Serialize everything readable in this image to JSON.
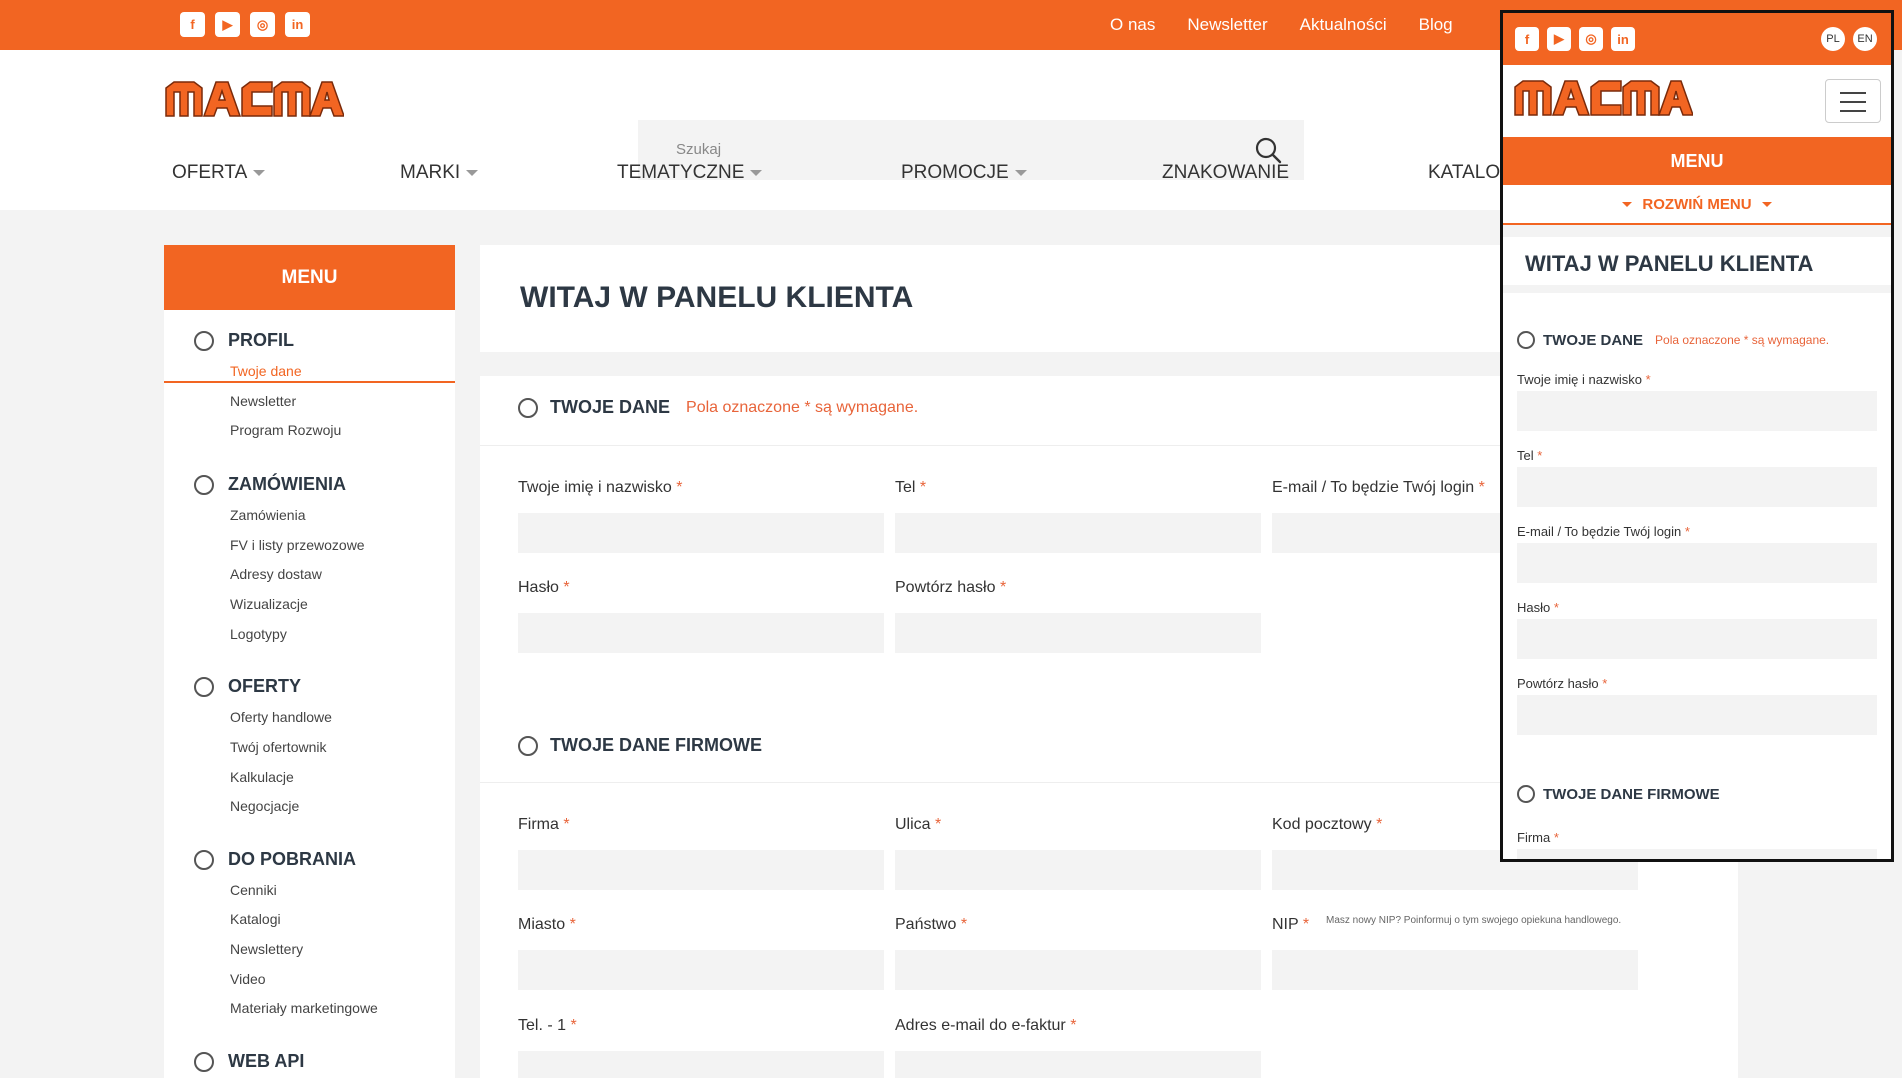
{
  "top_links": [
    "O nas",
    "Newsletter",
    "Aktualności",
    "Blog"
  ],
  "social": [
    {
      "icon": "facebook-icon",
      "glyph": "f"
    },
    {
      "icon": "youtube-icon",
      "glyph": "▶"
    },
    {
      "icon": "instagram-icon",
      "glyph": "◎"
    },
    {
      "icon": "linkedin-icon",
      "glyph": "in"
    }
  ],
  "logo_text": "MACMA",
  "search": {
    "placeholder": "Szukaj"
  },
  "main_nav": [
    "OFERTA",
    "MARKI",
    "TEMATYCZNE",
    "PROMOCJE",
    "ZNAKOWANIE",
    "KATALO"
  ],
  "sidebar": {
    "menu_title": "MENU",
    "sections": [
      {
        "title": "PROFIL",
        "items": [
          "Twoje dane",
          "Newsletter",
          "Program Rozwoju"
        ]
      },
      {
        "title": "ZAMÓWIENIA",
        "items": [
          "Zamówienia",
          "FV i listy przewozowe",
          "Adresy dostaw",
          "Wizualizacje",
          "Logotypy"
        ]
      },
      {
        "title": "OFERTY",
        "items": [
          "Oferty handlowe",
          "Twój ofertownik",
          "Kalkulacje",
          "Negocjacje"
        ]
      },
      {
        "title": "DO POBRANIA",
        "items": [
          "Cenniki",
          "Katalogi",
          "Newslettery",
          "Video",
          "Materiały marketingowe"
        ]
      },
      {
        "title": "WEB API",
        "items": []
      }
    ]
  },
  "main": {
    "welcome": "WITAJ W PANELU KLIENTA",
    "section1_title": "TWOJE DANE",
    "required_note": "Pola oznaczone * są wymagane.",
    "section2_title": "TWOJE DANE FIRMOWE",
    "star": "*",
    "fields1": [
      "Twoje imię i nazwisko",
      "Tel",
      "E-mail / To będzie Twój login",
      "Hasło",
      "Powtórz hasło"
    ],
    "fields2": [
      "Firma",
      "Ulica",
      "Kod pocztowy",
      "Miasto",
      "Państwo",
      "NIP",
      "Tel. - 1",
      "Adres e-mail do e-faktur"
    ],
    "nip_note": "Masz nowy NIP? Poinformuj o tym swojego opiekuna handlowego."
  },
  "mobile": {
    "lang": [
      "PL",
      "EN"
    ],
    "menu": "MENU",
    "expand": "ROZWIŃ MENU",
    "welcome": "WITAJ W PANELU KLIENTA",
    "section1_title": "TWOJE DANE",
    "required_note": "Pola oznaczone * są wymagane.",
    "fields": [
      "Twoje imię i nazwisko",
      "Tel",
      "E-mail / To będzie Twój login",
      "Hasło",
      "Powtórz hasło"
    ],
    "section2_title": "TWOJE DANE FIRMOWE",
    "field_firma": "Firma"
  },
  "colors": {
    "accent": "#f26522",
    "required": "#e8643a",
    "heading": "#2d3844"
  }
}
